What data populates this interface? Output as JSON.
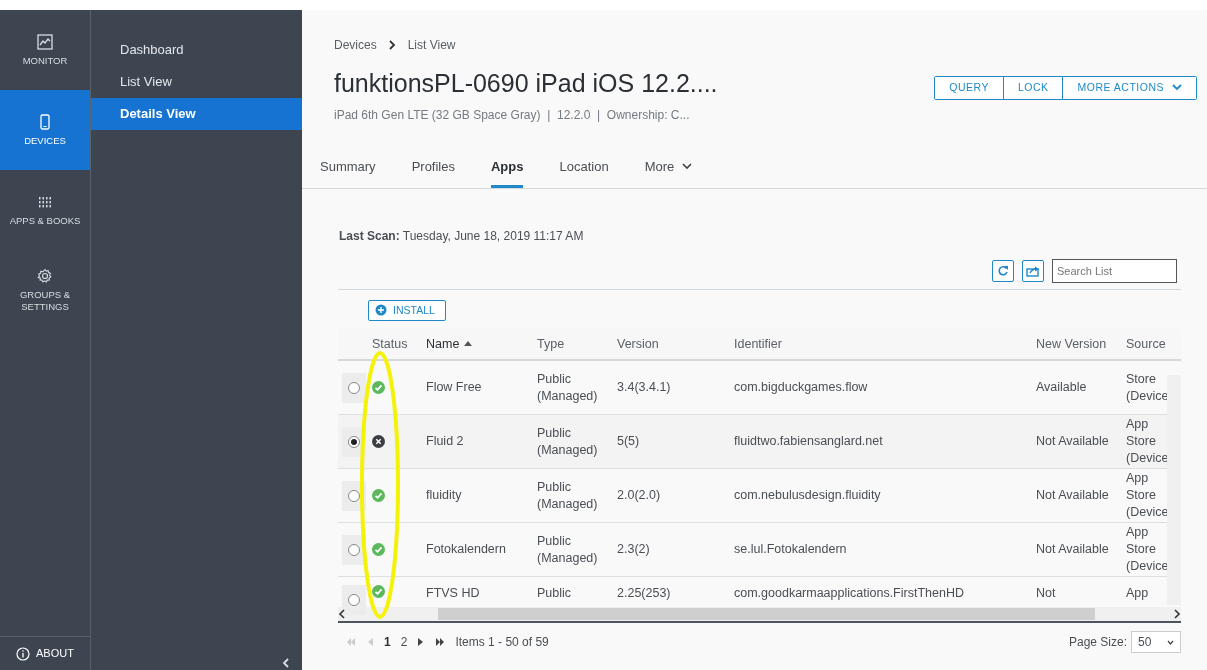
{
  "rail": [
    {
      "label": "MONITOR",
      "selected": false
    },
    {
      "label": "DEVICES",
      "selected": true
    },
    {
      "label": "APPS & BOOKS",
      "selected": false
    },
    {
      "label": "GROUPS & SETTINGS",
      "selected": false
    }
  ],
  "about": {
    "label": "ABOUT"
  },
  "subnav": [
    {
      "label": "Dashboard",
      "selected": false
    },
    {
      "label": "List View",
      "selected": false
    },
    {
      "label": "Details View",
      "selected": true
    }
  ],
  "breadcrumb": [
    "Devices",
    "List View"
  ],
  "title": "funktionsPL-0690 iPad iOS 12.2....",
  "subtitle": "iPad 6th Gen LTE (32 GB Space Gray)  |  12.2.0  |  Ownership: C...",
  "actions": [
    {
      "label": "QUERY",
      "kind": "button"
    },
    {
      "label": "LOCK",
      "kind": "button"
    },
    {
      "label": "MORE ACTIONS",
      "kind": "dropdown"
    }
  ],
  "tabs": [
    {
      "label": "Summary",
      "selected": false,
      "dropdown": false
    },
    {
      "label": "Profiles",
      "selected": false,
      "dropdown": false
    },
    {
      "label": "Apps",
      "selected": true,
      "dropdown": false
    },
    {
      "label": "Location",
      "selected": false,
      "dropdown": false
    },
    {
      "label": "More",
      "selected": false,
      "dropdown": true
    }
  ],
  "last_scan": {
    "label": "Last Scan:",
    "value": "Tuesday, June 18, 2019 11:17 AM"
  },
  "search": {
    "placeholder": "Search List"
  },
  "install": {
    "label": "INSTALL"
  },
  "columns": [
    {
      "label": "Status",
      "sorted": false
    },
    {
      "label": "Name",
      "sorted": true
    },
    {
      "label": "Type",
      "sorted": false
    },
    {
      "label": "Version",
      "sorted": false
    },
    {
      "label": "Identifier",
      "sorted": false
    },
    {
      "label": "New Version",
      "sorted": false
    },
    {
      "label": "Source",
      "sorted": false
    }
  ],
  "rows": [
    {
      "selected": false,
      "kind": "ok",
      "name": "Flow Free",
      "type": "Public (Managed)",
      "version": "3.4(3.4.1)",
      "identifier": "com.bigduckgames.flow",
      "new_version": "Available",
      "source": "Store (Device"
    },
    {
      "selected": true,
      "kind": "error",
      "name": "Fluid 2",
      "type": "Public (Managed)",
      "version": "5(5)",
      "identifier": "fluidtwo.fabiensanglard.net",
      "new_version": "Not Available",
      "source": "App Store (Device"
    },
    {
      "selected": false,
      "kind": "ok",
      "name": "fluidity",
      "type": "Public (Managed)",
      "version": "2.0(2.0)",
      "identifier": "com.nebulusdesign.fluidity",
      "new_version": "Not Available",
      "source": "App Store (Device"
    },
    {
      "selected": false,
      "kind": "ok",
      "name": "Fotokalendern",
      "type": "Public (Managed)",
      "version": "2.3(2)",
      "identifier": "se.lul.Fotokalendern",
      "new_version": "Not Available",
      "source": "App Store (Device"
    },
    {
      "selected": false,
      "kind": "ok",
      "name": "FTVS HD",
      "type": "Public",
      "version": "2.25(253)",
      "identifier": "com.goodkarmaapplications.FirstThenHD",
      "new_version": "Not",
      "source": "App"
    }
  ],
  "pagination": {
    "pages": [
      {
        "label": "1",
        "selected": true
      },
      {
        "label": "2",
        "selected": false
      }
    ],
    "summary": "Items 1 - 50 of 59"
  },
  "page_size": {
    "label": "Page Size:",
    "value": "50"
  },
  "annotations": [
    {
      "kind": "ellipse"
    }
  ]
}
